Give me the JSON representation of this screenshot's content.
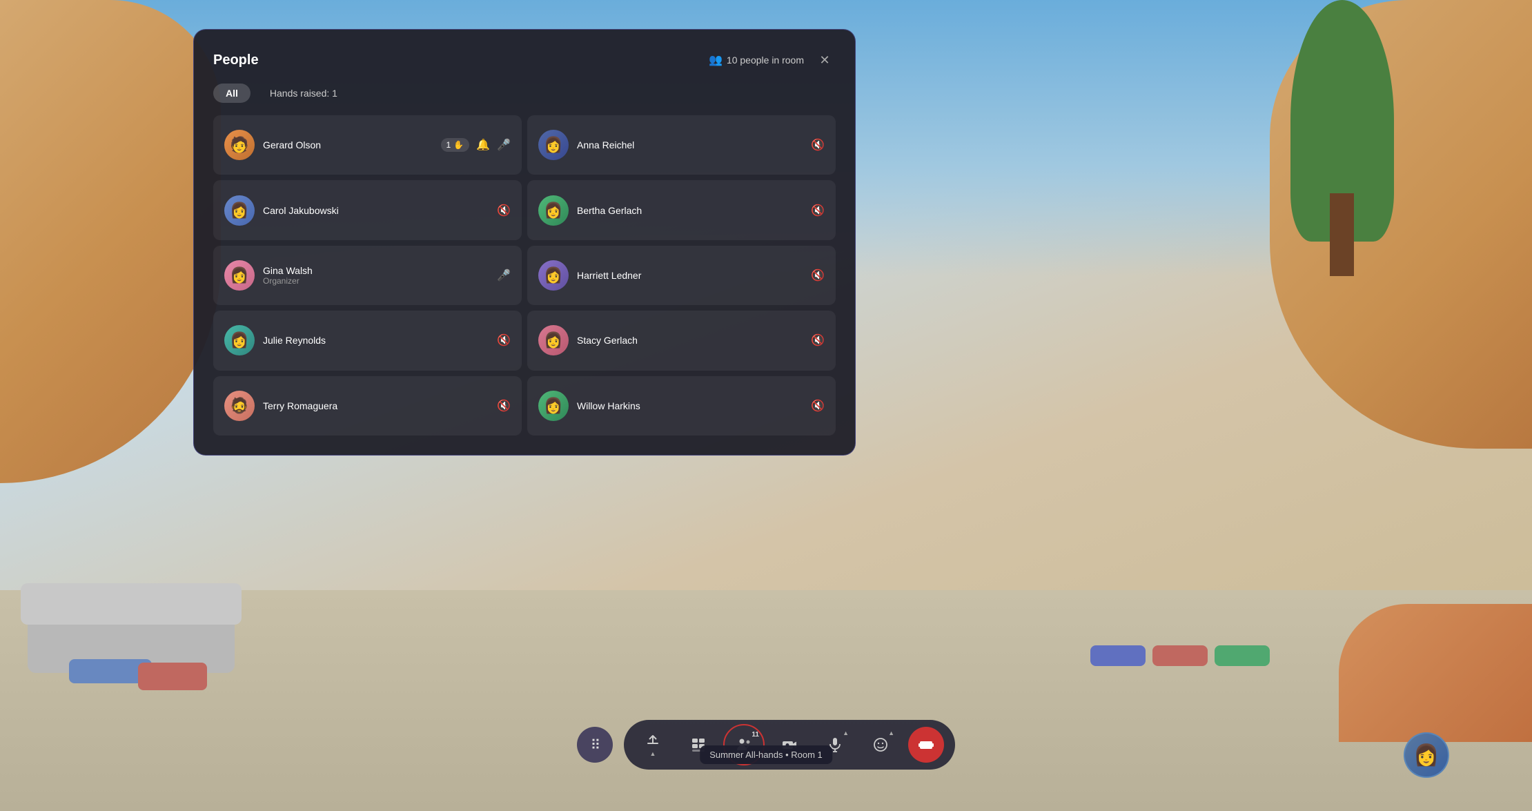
{
  "background": {
    "pillows_right": [
      {
        "color": "#6070c0",
        "label": "blue-pillow"
      },
      {
        "color": "#c06860",
        "label": "red-pillow"
      },
      {
        "color": "#50a870",
        "label": "green-pillow"
      }
    ]
  },
  "panel": {
    "title": "People",
    "people_count": "10 people in room",
    "close_label": "✕",
    "tabs": [
      {
        "id": "all",
        "label": "All",
        "active": true
      },
      {
        "id": "hands",
        "label": "Hands raised: 1",
        "active": false
      }
    ],
    "people": [
      {
        "id": "gerard-olson",
        "name": "Gerard Olson",
        "role": "",
        "avatar_color": "av-orange",
        "avatar_emoji": "🧑",
        "hand_raised": true,
        "hand_count": "1",
        "has_notification": true,
        "mic_state": "active",
        "column": 0
      },
      {
        "id": "anna-reichel",
        "name": "Anna Reichel",
        "role": "",
        "avatar_color": "av-dark-blue",
        "avatar_emoji": "👩",
        "hand_raised": false,
        "mic_state": "muted",
        "column": 1
      },
      {
        "id": "carol-jakubowski",
        "name": "Carol Jakubowski",
        "role": "",
        "avatar_color": "av-blue",
        "avatar_emoji": "👩",
        "hand_raised": false,
        "mic_state": "muted",
        "column": 0
      },
      {
        "id": "bertha-gerlach",
        "name": "Bertha Gerlach",
        "role": "",
        "avatar_color": "av-green",
        "avatar_emoji": "👩",
        "hand_raised": false,
        "mic_state": "muted",
        "column": 1
      },
      {
        "id": "gina-walsh",
        "name": "Gina Walsh",
        "role": "Organizer",
        "avatar_color": "av-pink",
        "avatar_emoji": "👩",
        "hand_raised": false,
        "mic_state": "active",
        "column": 0
      },
      {
        "id": "harriett-ledner",
        "name": "Harriett Ledner",
        "role": "",
        "avatar_color": "av-purple",
        "avatar_emoji": "👩",
        "hand_raised": false,
        "mic_state": "muted",
        "column": 1
      },
      {
        "id": "julie-reynolds",
        "name": "Julie Reynolds",
        "role": "",
        "avatar_color": "av-teal",
        "avatar_emoji": "👩",
        "hand_raised": false,
        "mic_state": "muted",
        "column": 0
      },
      {
        "id": "stacy-gerlach",
        "name": "Stacy Gerlach",
        "role": "",
        "avatar_color": "av-rose",
        "avatar_emoji": "👩",
        "hand_raised": false,
        "mic_state": "muted",
        "column": 1
      },
      {
        "id": "terry-romaguera",
        "name": "Terry Romaguera",
        "role": "",
        "avatar_color": "av-salmon",
        "avatar_emoji": "🧔",
        "hand_raised": false,
        "mic_state": "muted",
        "column": 0
      },
      {
        "id": "willow-harkins",
        "name": "Willow Harkins",
        "role": "",
        "avatar_color": "av-green",
        "avatar_emoji": "👩",
        "hand_raised": false,
        "mic_state": "muted",
        "column": 1
      }
    ]
  },
  "toolbar": {
    "apps_label": "⠿",
    "share_label": "↑",
    "gallery_label": "▦",
    "people_label": "👤",
    "people_count": "11",
    "camera_label": "📷",
    "mic_label": "🎤",
    "emoji_label": "😊",
    "end_label": "⏹",
    "tooltip": "Summer All-hands • Room 1"
  }
}
